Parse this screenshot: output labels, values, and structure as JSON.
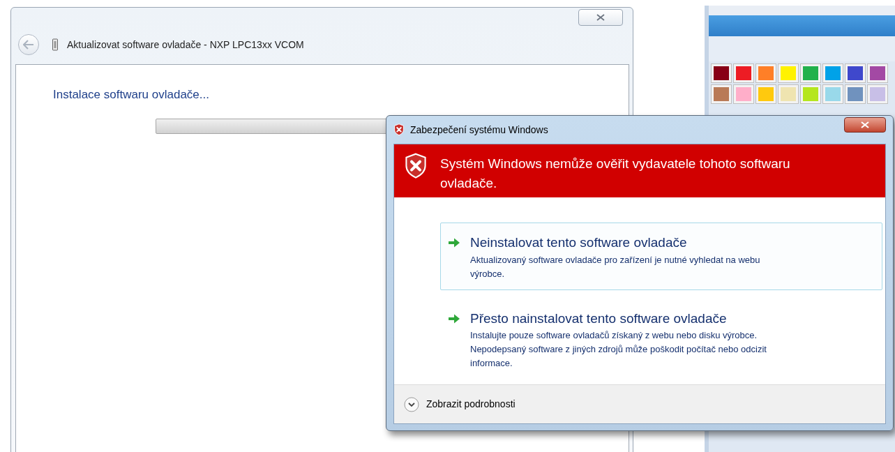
{
  "wizard": {
    "title": "Aktualizovat software ovladače - NXP LPC13xx VCOM",
    "heading": "Instalace softwaru ovladače...",
    "progress": {
      "level": 0
    }
  },
  "palette": {
    "swatches": [
      {
        "color": "#880015"
      },
      {
        "color": "#ed1c24"
      },
      {
        "color": "#ff7f27"
      },
      {
        "color": "#fff200"
      },
      {
        "color": "#22b14c"
      },
      {
        "color": "#00a2e8"
      },
      {
        "color": "#3f48cc"
      },
      {
        "color": "#a349a4"
      },
      {
        "color": "#b97a57"
      },
      {
        "color": "#ffaec9"
      },
      {
        "color": "#ffc90e"
      },
      {
        "color": "#efe4b0"
      },
      {
        "color": "#b5e61d"
      },
      {
        "color": "#99d9ea"
      },
      {
        "color": "#7092be"
      },
      {
        "color": "#c8bfe7"
      }
    ]
  },
  "security_dialog": {
    "title": "Zabezpečení systému Windows",
    "warning": "Systém Windows nemůže ověřit vydavatele tohoto softwaru ovladače.",
    "options": [
      {
        "title": "Neinstalovat tento software ovladače",
        "description": "Aktualizovaný software ovladače pro zařízení je nutné vyhledat na webu výrobce.",
        "selected": true
      },
      {
        "title": "Přesto nainstalovat tento software ovladače",
        "description": "Instalujte pouze software ovladačů získaný z webu nebo disku výrobce. Nepodepsaný software z jiných zdrojů může poškodit počítač nebo odcizit informace.",
        "selected": false
      }
    ],
    "details": {
      "label": "Zobrazit podrobnosti",
      "expanded": false
    }
  }
}
